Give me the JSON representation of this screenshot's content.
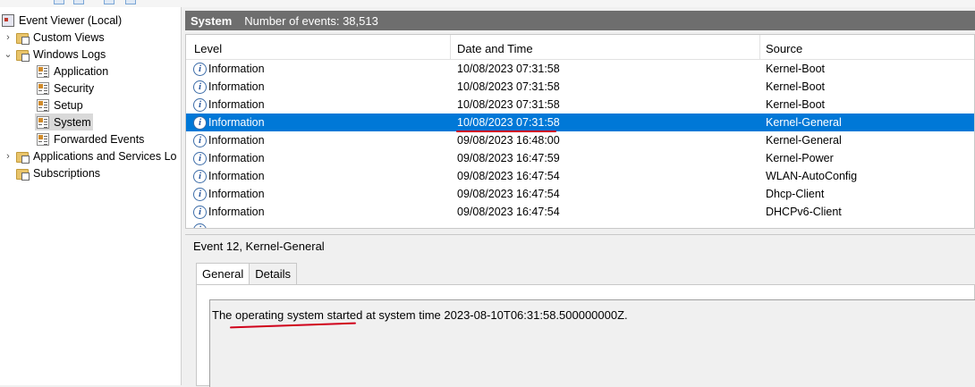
{
  "tree": {
    "root": "Event Viewer (Local)",
    "custom_views": "Custom Views",
    "windows_logs": "Windows Logs",
    "logs": [
      "Application",
      "Security",
      "Setup",
      "System",
      "Forwarded Events"
    ],
    "apps_services": "Applications and Services Lo",
    "subscriptions": "Subscriptions"
  },
  "header": {
    "title": "System",
    "count": "Number of events: 38,513"
  },
  "columns": {
    "level": "Level",
    "datetime": "Date and Time",
    "source": "Source"
  },
  "events": [
    {
      "level": "Information",
      "datetime": "10/08/2023 07:31:58",
      "source": "Kernel-Boot"
    },
    {
      "level": "Information",
      "datetime": "10/08/2023 07:31:58",
      "source": "Kernel-Boot"
    },
    {
      "level": "Information",
      "datetime": "10/08/2023 07:31:58",
      "source": "Kernel-Boot"
    },
    {
      "level": "Information",
      "datetime": "10/08/2023 07:31:58",
      "source": "Kernel-General"
    },
    {
      "level": "Information",
      "datetime": "09/08/2023 16:48:00",
      "source": "Kernel-General"
    },
    {
      "level": "Information",
      "datetime": "09/08/2023 16:47:59",
      "source": "Kernel-Power"
    },
    {
      "level": "Information",
      "datetime": "09/08/2023 16:47:54",
      "source": "WLAN-AutoConfig"
    },
    {
      "level": "Information",
      "datetime": "09/08/2023 16:47:54",
      "source": "Dhcp-Client"
    },
    {
      "level": "Information",
      "datetime": "09/08/2023 16:47:54",
      "source": "DHCPv6-Client"
    }
  ],
  "detail": {
    "title": "Event 12, Kernel-General",
    "tab_general": "General",
    "tab_details": "Details",
    "message": "The operating system started at system time 2023-08-10T06:31:58.500000000Z."
  },
  "colors": {
    "selection": "#0078d7",
    "annotation": "#d0021b",
    "header_bg": "#6e6e6e"
  }
}
